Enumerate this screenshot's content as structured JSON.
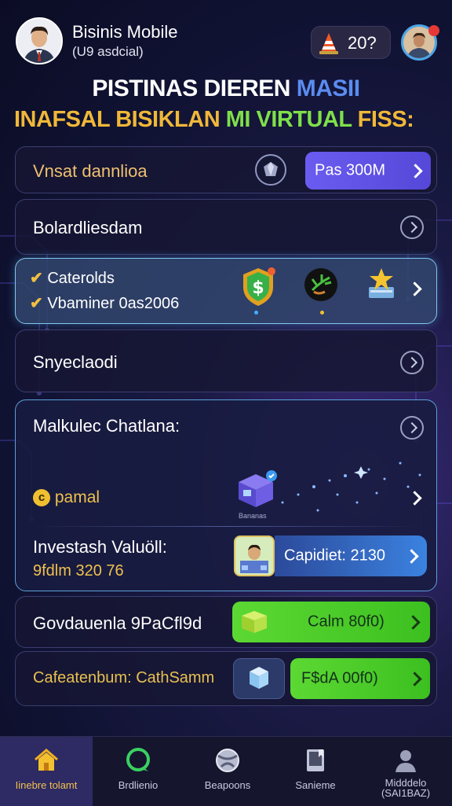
{
  "header": {
    "app_name": "Bisinis Mobile",
    "app_sub": "(U9 asdcial)",
    "coin_count": "20?"
  },
  "headline": {
    "line1_main": "PISTINAS DIEREN",
    "line1_accent": "MASII",
    "line2_start": "INAFSAL BISIKLAN",
    "line2_mid": "MI VIRTUAL",
    "line2_end": "FISS:"
  },
  "cards": {
    "row1": {
      "label": "Vnsat dannlioa",
      "button": "Pas 300M"
    },
    "row2": {
      "label": "Bolardliesdam"
    },
    "row3": {
      "check1": "Caterolds",
      "check2": "Vbaminer 0as2006"
    },
    "row4": {
      "label": "Snyeclaodi"
    },
    "row5": {
      "label": "Malkulec Chatlana:",
      "coin_label": "pamal",
      "box_caption": "Bananas",
      "invest_label": "Investash Valuöll:",
      "invest_value": "9fdlm 320 76",
      "invest_button": "Capidiet: 2130"
    },
    "row6": {
      "label": "Govdauenla 9PaCfl9d",
      "button": "Calm 80f0)"
    },
    "row7": {
      "label": "Cafeatenbum: CathSamm",
      "button": "F$dA 00f0)"
    }
  },
  "nav": [
    {
      "label": "Iinebre tolamt",
      "icon": "home-icon"
    },
    {
      "label": "Brdlienio",
      "icon": "chat-icon"
    },
    {
      "label": "Beapoons",
      "icon": "globe-icon"
    },
    {
      "label": "Sanieme",
      "icon": "book-icon"
    },
    {
      "label": "Midddelo (SAI1BAZ)",
      "icon": "person-icon"
    }
  ],
  "colors": {
    "accent_blue": "#5a8cf0",
    "headline_gold": "#f0b838",
    "headline_green": "#7fe04a",
    "button_purple": "#6a5cf0",
    "button_green": "#5cd833",
    "nav_active": "#2e2a64"
  }
}
